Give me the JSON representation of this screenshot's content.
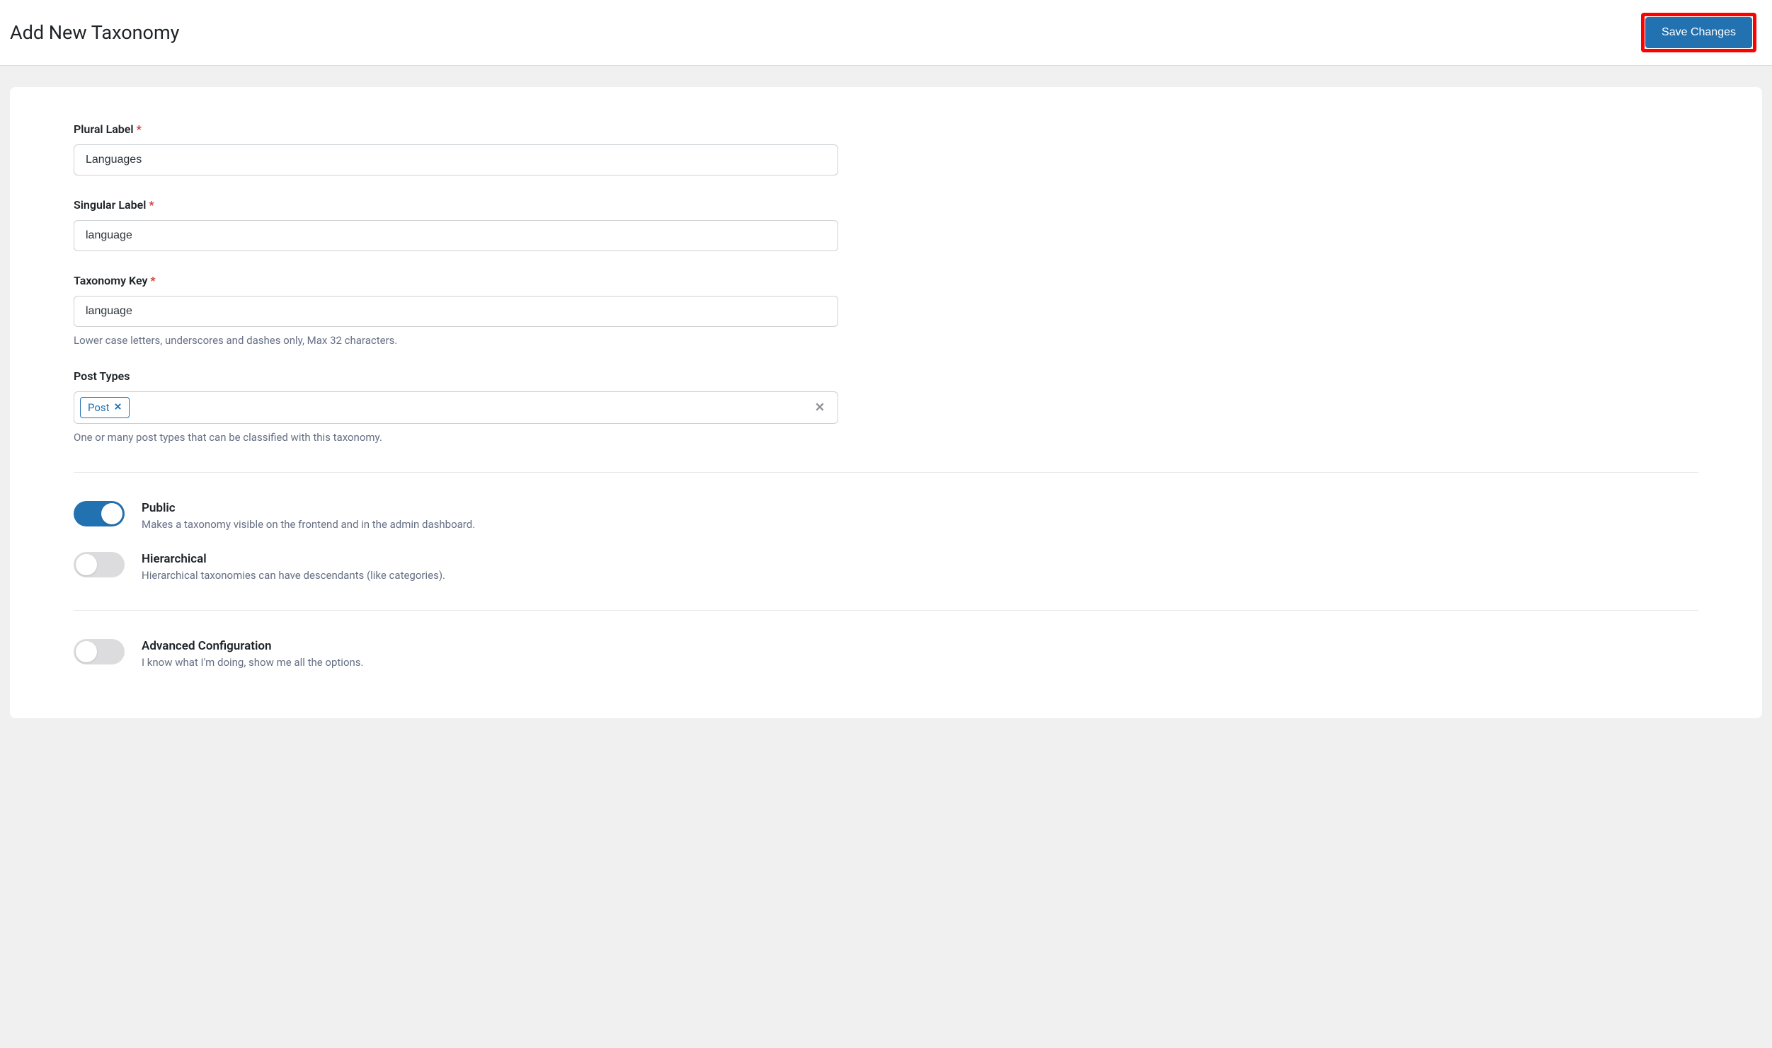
{
  "header": {
    "title": "Add New Taxonomy",
    "save_label": "Save Changes"
  },
  "fields": {
    "plural": {
      "label": "Plural Label",
      "value": "Languages"
    },
    "singular": {
      "label": "Singular Label",
      "value": "language"
    },
    "key": {
      "label": "Taxonomy Key",
      "value": "language",
      "help": "Lower case letters, underscores and dashes only, Max 32 characters."
    },
    "post_types": {
      "label": "Post Types",
      "tags": [
        "Post"
      ],
      "help": "One or many post types that can be classified with this taxonomy."
    }
  },
  "toggles": {
    "public": {
      "label": "Public",
      "desc": "Makes a taxonomy visible on the frontend and in the admin dashboard.",
      "on": true
    },
    "hierarchical": {
      "label": "Hierarchical",
      "desc": "Hierarchical taxonomies can have descendants (like categories).",
      "on": false
    },
    "advanced": {
      "label": "Advanced Configuration",
      "desc": "I know what I'm doing, show me all the options.",
      "on": false
    }
  }
}
